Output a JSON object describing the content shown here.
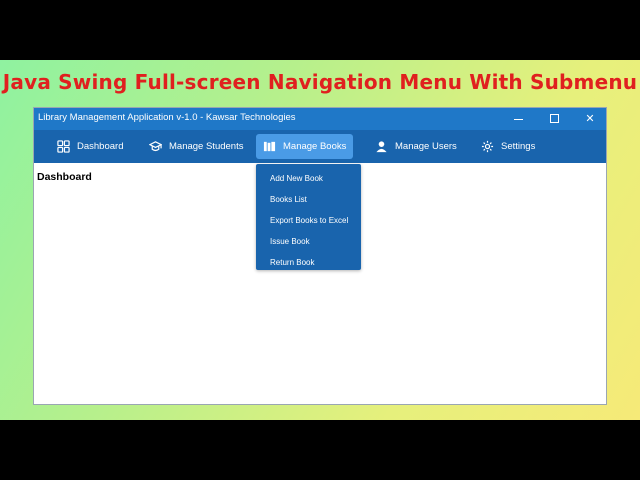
{
  "banner": {
    "headline": "Java Swing Full-screen Navigation Menu With Submenu",
    "colors": {
      "headline": "#e0201f",
      "gradient_start": "#8ff2a0",
      "gradient_end": "#f6ea78"
    }
  },
  "window": {
    "title": "Library Management Application v-1.0 - Kawsar Technologies",
    "controls": {
      "minimize": "minimize-icon",
      "maximize": "maximize-icon",
      "close": "✕"
    },
    "colors": {
      "titlebar": "#1f78c8",
      "menubar": "#1964ad",
      "active_item": "#4a9be6"
    }
  },
  "menubar": {
    "items": [
      {
        "label": "Dashboard",
        "icon": "dashboard-icon",
        "active": false
      },
      {
        "label": "Manage Students",
        "icon": "graduation-cap-icon",
        "active": false
      },
      {
        "label": "Manage Books",
        "icon": "books-icon",
        "active": true
      },
      {
        "label": "Manage Users",
        "icon": "user-icon",
        "active": false
      },
      {
        "label": "Settings",
        "icon": "gear-icon",
        "active": false
      }
    ]
  },
  "submenu": {
    "items": [
      {
        "label": "Add New Book"
      },
      {
        "label": "Books List"
      },
      {
        "label": "Export Books to Excel"
      },
      {
        "label": "Issue Book"
      },
      {
        "label": "Return Book"
      }
    ]
  },
  "content": {
    "title": "Dashboard"
  }
}
